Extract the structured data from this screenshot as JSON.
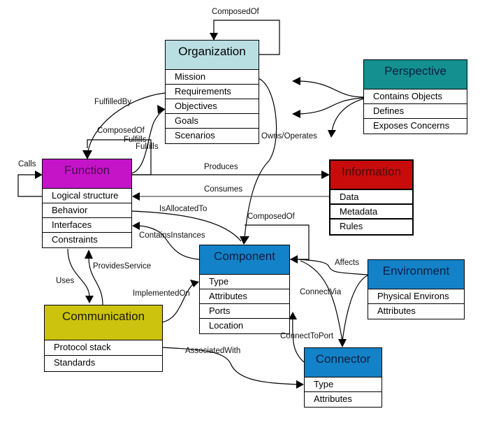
{
  "entities": {
    "organization": {
      "title": "Organization",
      "color": "#b9dfe3",
      "title_color": "#000000",
      "attributes": [
        "Mission",
        "Requirements",
        "Objectives",
        "Goals",
        "Scenarios"
      ]
    },
    "perspective": {
      "title": "Perspective",
      "color": "#13908f",
      "title_color": "#0a1f40",
      "attributes": [
        "Contains Objects",
        "Defines",
        "Exposes Concerns"
      ]
    },
    "function": {
      "title": "Function",
      "color": "#c514c8",
      "title_color": "#4a0a4e",
      "attributes": [
        "Logical structure",
        "Behavior",
        "Interfaces",
        "Constraints"
      ]
    },
    "information": {
      "title": "Information",
      "color": "#c80c0c",
      "title_color": "#4a0a0a",
      "attributes": [
        "Data",
        "Metadata",
        "Rules"
      ]
    },
    "component": {
      "title": "Component",
      "color": "#1482c8",
      "title_color": "#0a1f40",
      "attributes": [
        "Type",
        "Attributes",
        "Ports",
        "Location"
      ]
    },
    "environment": {
      "title": "Environment",
      "color": "#1482c8",
      "title_color": "#0a1f40",
      "attributes": [
        "Physical Environs",
        "Attributes"
      ]
    },
    "communication": {
      "title": "Communication",
      "color": "#ccc30e",
      "title_color": "#1a1a00",
      "attributes": [
        "Protocol stack",
        "Standards"
      ]
    },
    "connector": {
      "title": "Connector",
      "color": "#1482c8",
      "title_color": "#0a1f40",
      "attributes": [
        "Type",
        "Attributes"
      ]
    }
  },
  "relationships": {
    "org_composed_of": "ComposedOf",
    "fulfilled_by": "FulfilledBy",
    "function_composed_of": "ComposedOf",
    "fulfills_1": "Fulfills",
    "fulfills_2": "Fulfills",
    "calls": "Calls",
    "owns_operates": "Owns/Operates",
    "produces": "Produces",
    "consumes": "Consumes",
    "is_allocated_to": "IsAllocatedTo",
    "component_composed_of": "ComposedOf",
    "contains_instances": "ContainsInstances",
    "provides_service": "ProvidesService",
    "uses": "Uses",
    "implemented_on": "ImplementedOn",
    "affects": "Affects",
    "connect_via": "ConnectVia",
    "connect_to_port": "ConnectToPort",
    "associated_with": "AssociatedWith"
  }
}
